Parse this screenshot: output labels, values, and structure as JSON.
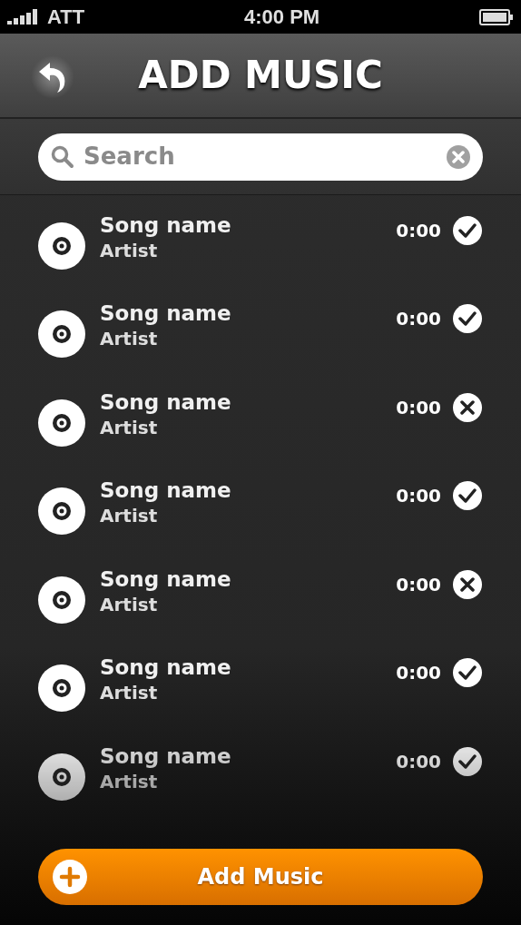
{
  "status_bar": {
    "carrier": "ATT",
    "time": "4:00 PM"
  },
  "header": {
    "title": "ADD MUSIC"
  },
  "search": {
    "placeholder": "Search"
  },
  "songs": [
    {
      "title": "Song name",
      "artist": "Artist",
      "duration": "0:00",
      "added": true
    },
    {
      "title": "Song name",
      "artist": "Artist",
      "duration": "0:00",
      "added": true
    },
    {
      "title": "Song name",
      "artist": "Artist",
      "duration": "0:00",
      "added": false
    },
    {
      "title": "Song name",
      "artist": "Artist",
      "duration": "0:00",
      "added": true
    },
    {
      "title": "Song name",
      "artist": "Artist",
      "duration": "0:00",
      "added": false
    },
    {
      "title": "Song name",
      "artist": "Artist",
      "duration": "0:00",
      "added": true
    },
    {
      "title": "Song name",
      "artist": "Artist",
      "duration": "0:00",
      "added": true
    }
  ],
  "add_button": {
    "label": "Add Music"
  }
}
